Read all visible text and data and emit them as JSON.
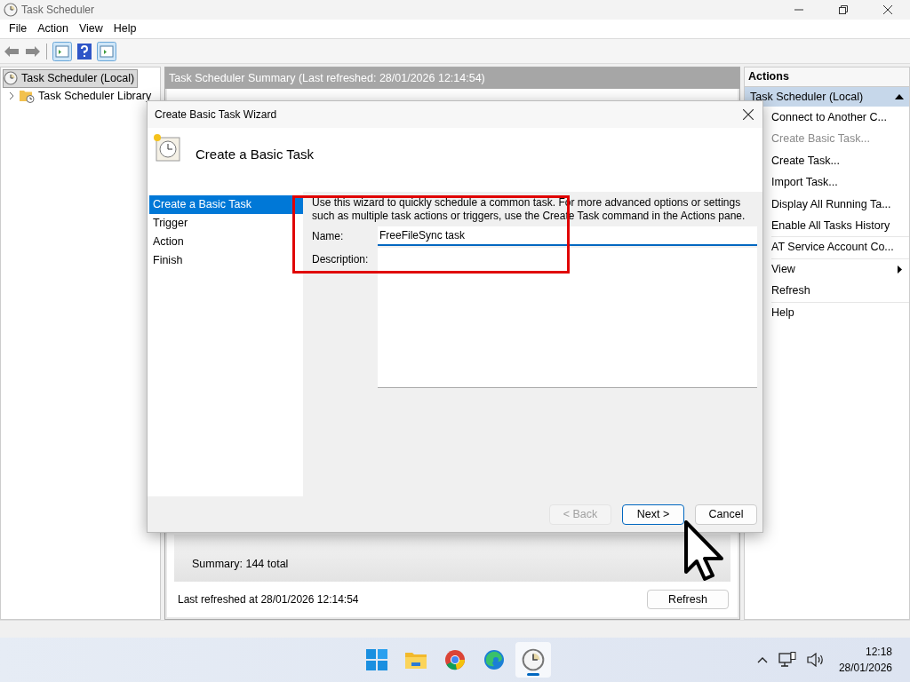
{
  "window": {
    "title": "Task Scheduler"
  },
  "menu": [
    "File",
    "Action",
    "View",
    "Help"
  ],
  "tree": [
    {
      "label": "Task Scheduler (Local)",
      "selected": true,
      "children": [
        {
          "label": "Task Scheduler Library",
          "expanded": false
        }
      ]
    }
  ],
  "summary": {
    "header": "Task Scheduler Summary (Last refreshed: 28/01/2026 12:14:54)",
    "total": "Summary: 144 total",
    "last_refreshed": "Last refreshed at 28/01/2026 12:14:54",
    "refresh_button": "Refresh"
  },
  "actions": {
    "title": "Actions",
    "group": "Task Scheduler (Local)",
    "items": [
      {
        "label": "Connect to Another C...",
        "disabled": false,
        "submenu": false,
        "divider": false
      },
      {
        "label": "Create Basic Task...",
        "disabled": true,
        "submenu": false,
        "divider": false
      },
      {
        "label": "Create Task...",
        "disabled": false,
        "submenu": false,
        "divider": false
      },
      {
        "label": "Import Task...",
        "disabled": false,
        "submenu": false,
        "divider": false
      },
      {
        "label": "Display All Running Ta...",
        "disabled": false,
        "submenu": false,
        "divider": false
      },
      {
        "label": "Enable All Tasks History",
        "disabled": false,
        "submenu": false,
        "divider": true
      },
      {
        "label": "AT Service Account Co...",
        "disabled": false,
        "submenu": false,
        "divider": true
      },
      {
        "label": "View",
        "disabled": false,
        "submenu": true,
        "divider": false
      },
      {
        "label": "Refresh",
        "disabled": false,
        "submenu": false,
        "divider": true
      },
      {
        "label": "Help",
        "disabled": false,
        "submenu": false,
        "divider": false
      }
    ]
  },
  "wizard": {
    "title": "Create Basic Task Wizard",
    "heading": "Create a Basic Task",
    "steps": [
      {
        "label": "Create a Basic Task",
        "selected": true
      },
      {
        "label": "Trigger",
        "selected": false
      },
      {
        "label": "Action",
        "selected": false
      },
      {
        "label": "Finish",
        "selected": false
      }
    ],
    "intro": "Use this wizard to quickly schedule a common task.  For more advanced options or settings such as multiple task actions or triggers, use the Create Task command in the Actions pane.",
    "name_label": "Name:",
    "name_value": "FreeFileSync task",
    "description_label": "Description:",
    "buttons": [
      {
        "label": "< Back",
        "disabled": true,
        "default": false
      },
      {
        "label": "Next >",
        "disabled": false,
        "default": true
      },
      {
        "label": "Cancel",
        "disabled": false,
        "default": false
      }
    ]
  },
  "taskbar": {
    "apps": [
      {
        "kind": "start",
        "active": false
      },
      {
        "kind": "files",
        "active": false
      },
      {
        "kind": "chrome",
        "active": false
      },
      {
        "kind": "edge",
        "active": false
      },
      {
        "kind": "scheduler",
        "active": true
      }
    ],
    "time": "12:18",
    "date": "28/01/2026"
  }
}
